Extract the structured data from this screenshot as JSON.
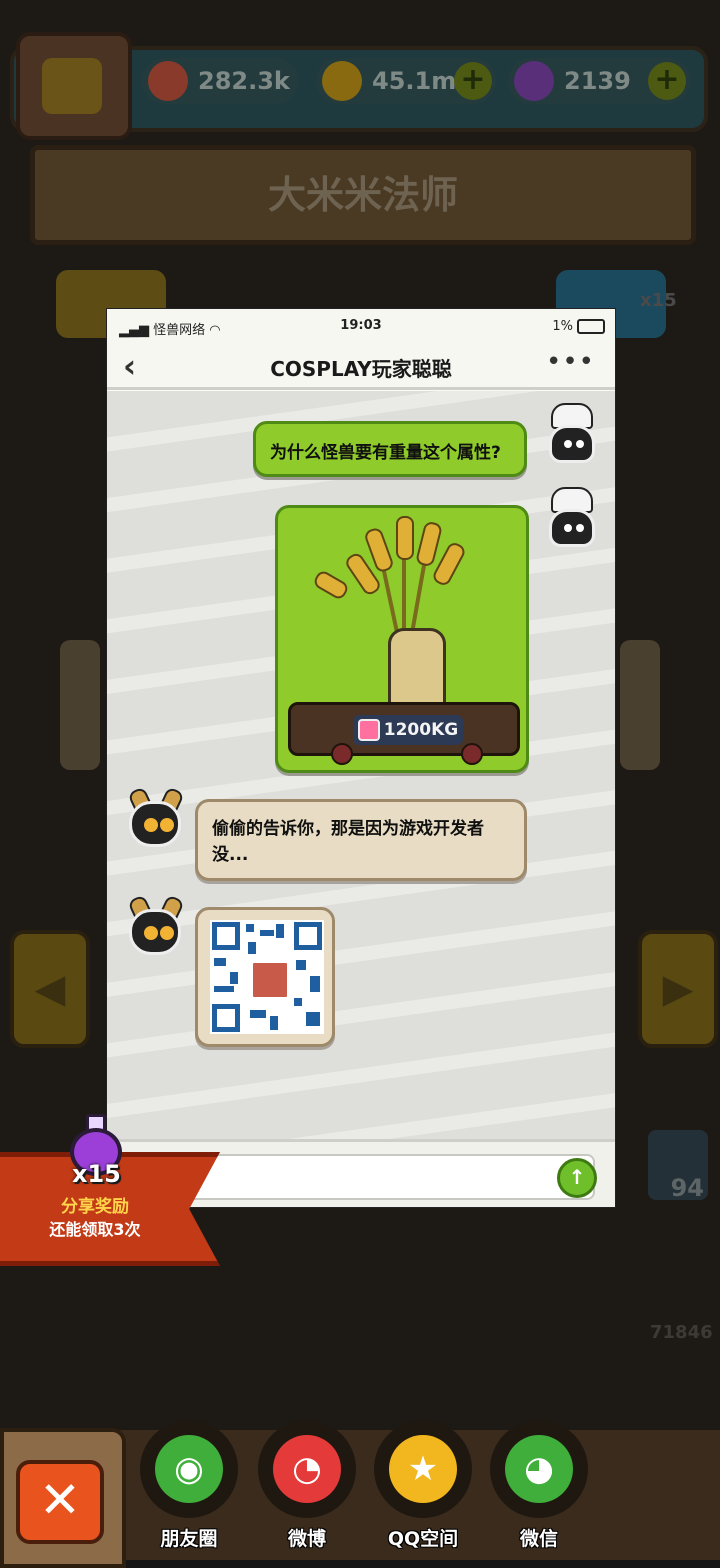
{
  "hud": {
    "eyes": "282.3k",
    "coins": "45.1m",
    "potions": "2139"
  },
  "background": {
    "banner_title": "大米米法师",
    "potion_badge": "x15",
    "card_count": "94",
    "side_value": "71846"
  },
  "phone": {
    "status": {
      "carrier": "怪兽网络",
      "time": "19:03",
      "battery": "1%"
    },
    "nav": {
      "title": "COSPLAY玩家聪聪",
      "back": "‹",
      "more": "•••"
    },
    "messages": [
      {
        "from": "me",
        "text": "为什么怪兽要有重量这个属性?"
      },
      {
        "from": "me",
        "weight": "1200KG"
      },
      {
        "from": "friend",
        "text": "偷偷的告诉你，那是因为游戏开发者没..."
      }
    ]
  },
  "reward": {
    "count": "x15",
    "title": "分享奖励",
    "subtitle": "还能领取3次"
  },
  "share": {
    "close": "✕",
    "options": [
      {
        "label": "朋友圈",
        "color": "#3fae3a"
      },
      {
        "label": "微博",
        "color": "#e43a3a"
      },
      {
        "label": "QQ空间",
        "color": "#f2b71e"
      },
      {
        "label": "微信",
        "color": "#3fae3a"
      }
    ]
  }
}
